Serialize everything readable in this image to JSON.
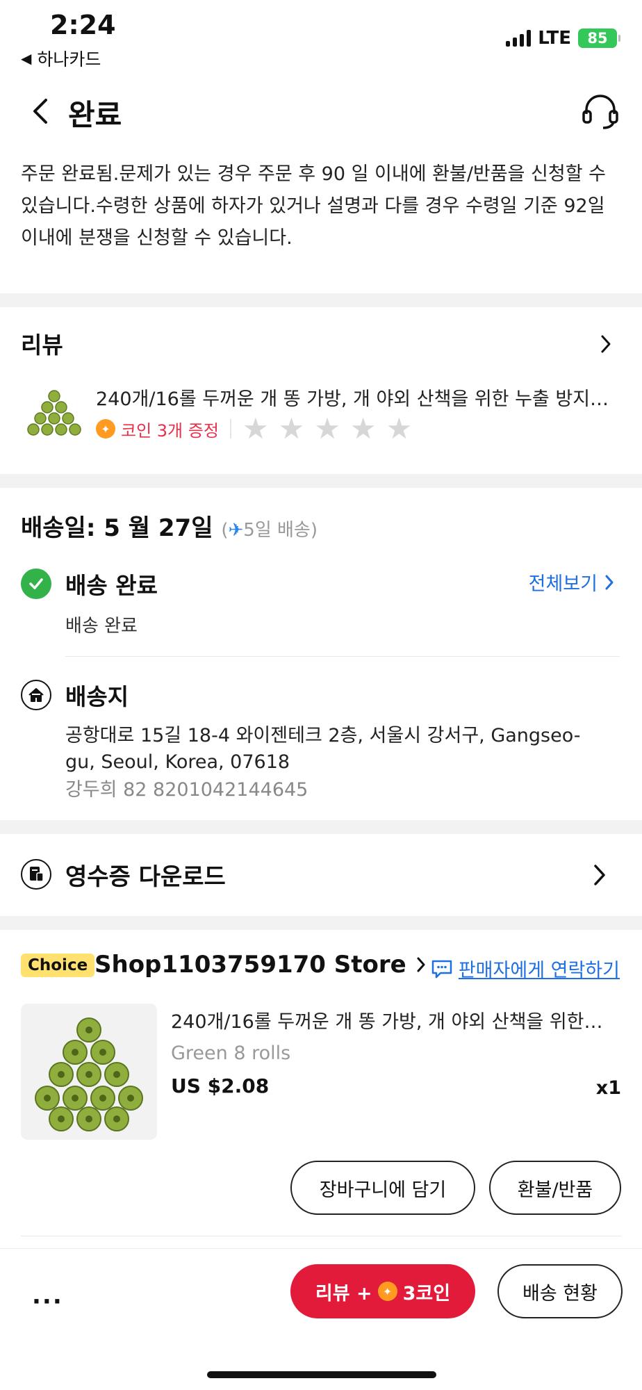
{
  "status_bar": {
    "time": "2:24",
    "back_app": "하나카드",
    "network": "LTE",
    "battery": "85"
  },
  "header": {
    "title": "완료"
  },
  "notice": "주문 완료됨.문제가 있는 경우 주문 후 90 일 이내에 환불/반품을 신청할 수 있습니다.수령한 상품에 하자가 있거나 설명과 다를 경우 수령일 기준 92일 이내에 분쟁을 신청할 수 있습니다.",
  "review": {
    "title": "리뷰",
    "product_name": "240개/16롤 두꺼운 개 똥 가방, 개 야외 산책을 위한 누출 방지…",
    "coin_text": "코인 3개 증정",
    "star_count": 5
  },
  "delivery": {
    "date": "배송일: 5 월 27일",
    "paren_open": "(",
    "shipping_days": "5일 배송",
    "paren_close": ")",
    "status": "배송 완료",
    "view_all": "전체보기",
    "detail": "배송 완료"
  },
  "address": {
    "title": "배송지",
    "text": "공항대로 15길 18-4 와이젠테크 2층, 서울시 강서구, Gangseo-gu, Seoul, Korea, 07618",
    "recipient": "강두희 82 8201042144645"
  },
  "receipt": {
    "title": "영수증 다운로드"
  },
  "store": {
    "badge": "Choice",
    "name": "Shop1103759170 Store",
    "contact": "판매자에게 연락하기",
    "product": {
      "name": "240개/16롤 두꺼운 개 똥 가방, 개 야외 산책을 위한…",
      "variant": "Green 8 rolls",
      "price": "US $2.08",
      "qty": "x1"
    },
    "add_to_cart": "장바구니에 담기",
    "refund": "환불/반품"
  },
  "bottom_bar": {
    "more": "···",
    "review_prefix": "리뷰 +",
    "review_suffix": "3코인",
    "tracking": "배송 현황"
  },
  "colors": {
    "accent_red": "#e21b3a",
    "link_blue": "#1f6fe0",
    "success_green": "#33b24a",
    "coin_orange": "#ff9b21",
    "choice_yellow": "#ffe170"
  }
}
